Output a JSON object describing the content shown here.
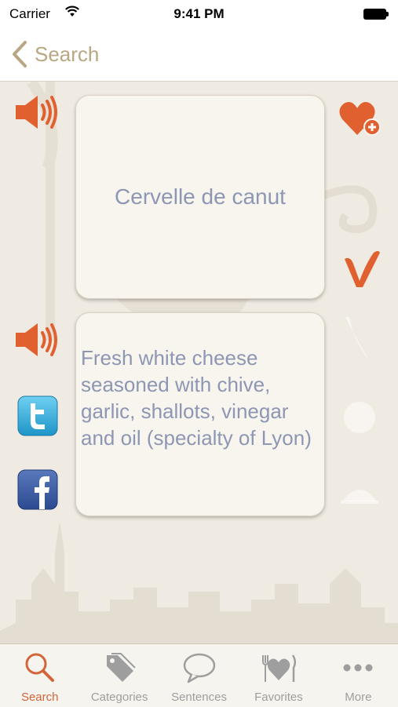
{
  "status_bar": {
    "carrier": "Carrier",
    "time": "9:41 PM"
  },
  "nav": {
    "back_label": "Search"
  },
  "entry": {
    "term": "Cervelle de canut",
    "definition": "Fresh white cheese seasoned with chive, garlic, shallots, vinegar and oil (specialty of Lyon)"
  },
  "colors": {
    "accent": "#d2653a",
    "back_tint": "#b8a782",
    "text_blue": "#8d97b3",
    "background": "#f0ebe2"
  },
  "icons": [
    "speaker-icon",
    "heart-add-icon",
    "v-logo-icon",
    "twitter-icon",
    "facebook-icon"
  ],
  "tabs": [
    {
      "label": "Search",
      "icon": "search-icon",
      "active": true
    },
    {
      "label": "Categories",
      "icon": "tag-icon",
      "active": false
    },
    {
      "label": "Sentences",
      "icon": "speech-bubble-icon",
      "active": false
    },
    {
      "label": "Favorites",
      "icon": "heart-cutlery-icon",
      "active": false
    },
    {
      "label": "More",
      "icon": "more-dots-icon",
      "active": false
    }
  ]
}
